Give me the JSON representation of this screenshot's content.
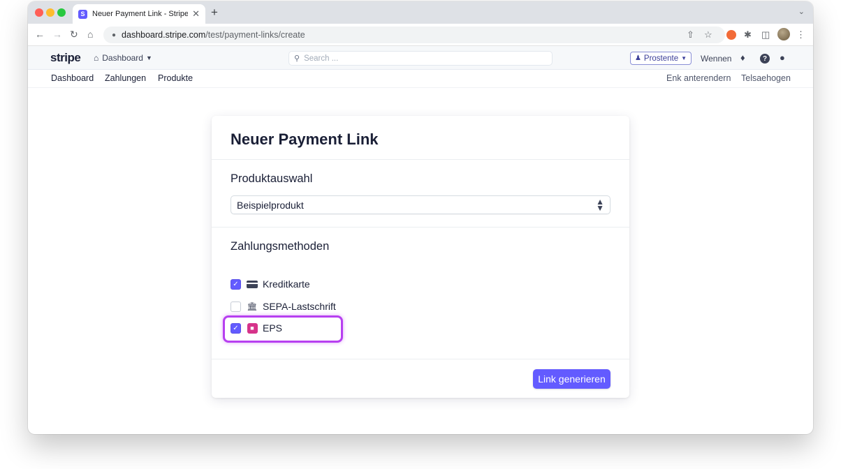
{
  "browser": {
    "tab_title": "Neuer Payment Link - Stripe I",
    "favicon_letter": "S",
    "tab_close": "✕",
    "new_tab": "+",
    "url_host": "dashboard.stripe.com",
    "url_path": "/test/payment-links/create"
  },
  "header": {
    "logo": "stripe",
    "context_label": "Dashboard",
    "search_placeholder": "Search ...",
    "env_button": "Prostente",
    "link_wennen": "Wennen"
  },
  "subnav": {
    "items": [
      "Dashboard",
      "Zahlungen",
      "Produkte"
    ],
    "right_items": [
      "Enk anterendern",
      "Telsaehogen"
    ]
  },
  "card": {
    "title": "Neuer Payment Link",
    "product_section_label": "Produktauswahl",
    "product_select_value": "Beispielprodukt",
    "payment_section_label": "Zahlungsmethoden",
    "payment_methods": [
      {
        "label": "Kreditkarte",
        "checked": true,
        "icon": "credit-card-icon"
      },
      {
        "label": "SEPA-Lastschrift",
        "checked": false,
        "icon": "bank-icon"
      },
      {
        "label": "EPS",
        "checked": true,
        "icon": "eps-icon",
        "highlighted": true
      }
    ],
    "generate_button": "Link generieren"
  },
  "colors": {
    "accent": "#635bff",
    "highlight": "#b73ff0",
    "eps": "#d6338a"
  }
}
